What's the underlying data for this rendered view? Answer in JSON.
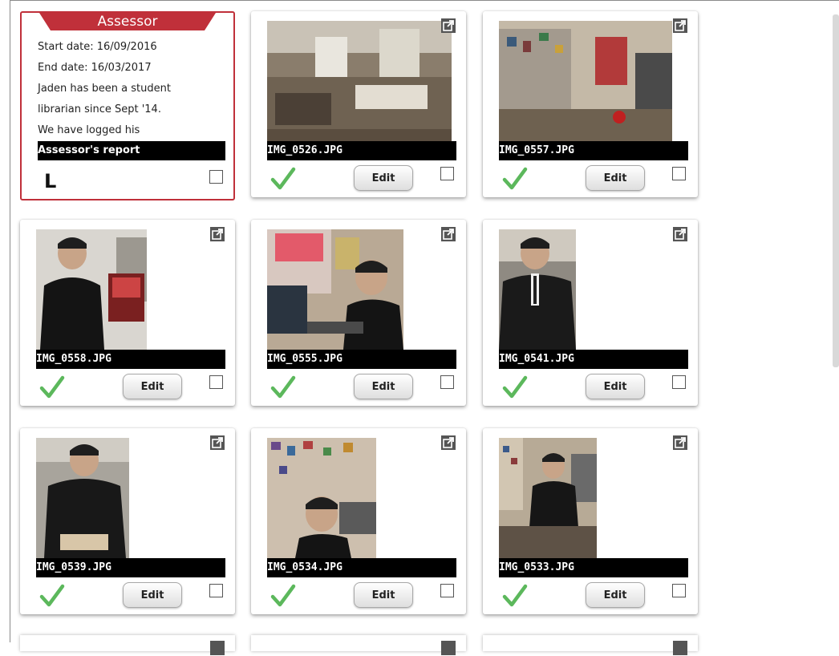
{
  "assessor": {
    "title": "Assessor",
    "lines": [
      "Start date: 16/09/2016",
      "End date: 16/03/2017",
      "Jaden has been a student",
      "librarian since Sept '14.",
      "We have logged his"
    ],
    "report_label": "Assessor's report",
    "level": "L"
  },
  "edit_label": "Edit",
  "cards": [
    {
      "filename": "IMG_0526.JPG",
      "approved": true
    },
    {
      "filename": "IMG_0557.JPG",
      "approved": true
    },
    {
      "filename": "IMG_0558.JPG",
      "approved": true
    },
    {
      "filename": "IMG_0555.JPG",
      "approved": true
    },
    {
      "filename": "IMG_0541.JPG",
      "approved": true
    },
    {
      "filename": "IMG_0539.JPG",
      "approved": true
    },
    {
      "filename": "IMG_0534.JPG",
      "approved": true
    },
    {
      "filename": "IMG_0533.JPG",
      "approved": true
    }
  ],
  "colors": {
    "accent": "#c0303a",
    "check": "#5cb85c",
    "caption_bg": "#000000"
  },
  "icons": [
    "external-link-icon",
    "checkmark-icon"
  ]
}
